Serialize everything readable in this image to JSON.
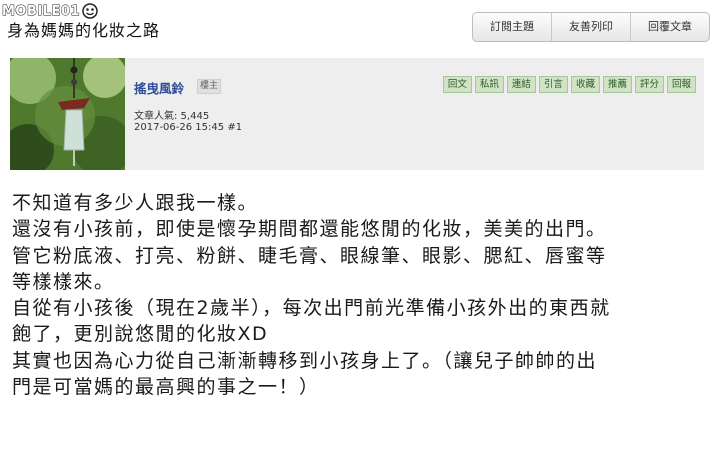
{
  "site": {
    "logo_text": "MOBILE01"
  },
  "topic": {
    "title": "身為媽媽的化妝之路"
  },
  "toolbar": {
    "buttons": [
      "訂閱主題",
      "友善列印",
      "回覆文章"
    ]
  },
  "post": {
    "author": "搖曳風鈴",
    "role": "樓主",
    "popularity": "文章人氣: 5,445",
    "timestamp": "2017-06-26 15:45",
    "floor": "#1",
    "actions": [
      "回文",
      "私訊",
      "連結",
      "引言",
      "收藏",
      "推薦",
      "評分",
      "回報"
    ],
    "content_lines": [
      "不知道有多少人跟我一樣。",
      "還沒有小孩前，即使是懷孕期間都還能悠閒的化妝，美美的出門。",
      "管它粉底液、打亮、粉餅、睫毛膏、眼線筆、眼影、腮紅、唇蜜等",
      "等樣樣來。",
      "自從有小孩後（現在2歲半），每次出門前光準備小孩外出的東西就",
      "飽了，更別說悠閒的化妝XD",
      "其實也因為心力從自己漸漸轉移到小孩身上了。（讓兒子帥帥的出",
      "門是可當媽的最高興的事之一！）"
    ]
  }
}
